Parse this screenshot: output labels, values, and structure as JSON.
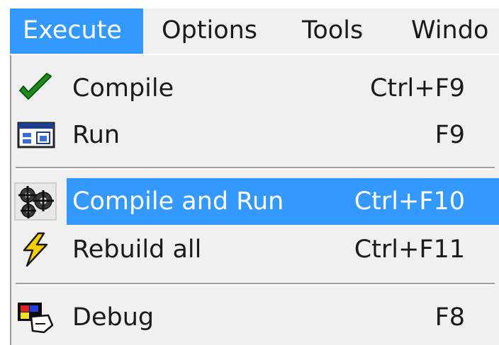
{
  "menubar": {
    "items": [
      {
        "label": "Execute",
        "active": true
      },
      {
        "label": "Options",
        "active": false
      },
      {
        "label": "Tools",
        "active": false
      },
      {
        "label": "Windo",
        "active": false
      }
    ]
  },
  "menu": {
    "items": [
      {
        "label": "Compile",
        "shortcut": "Ctrl+F9",
        "icon": "checkmark-icon",
        "highlighted": false
      },
      {
        "label": "Run",
        "shortcut": "F9",
        "icon": "run-window-icon",
        "highlighted": false
      },
      {
        "label": "Compile and Run",
        "shortcut": "Ctrl+F10",
        "icon": "gears-icon",
        "highlighted": true
      },
      {
        "label": "Rebuild all",
        "shortcut": "Ctrl+F11",
        "icon": "lightning-icon",
        "highlighted": false
      },
      {
        "label": "Debug",
        "shortcut": "F8",
        "icon": "debug-icon",
        "highlighted": false
      }
    ]
  },
  "colors": {
    "highlight": "#3399ff",
    "menu_background": "#f0f0f0",
    "text": "#1a1a1a",
    "highlight_text": "#ffffff"
  }
}
